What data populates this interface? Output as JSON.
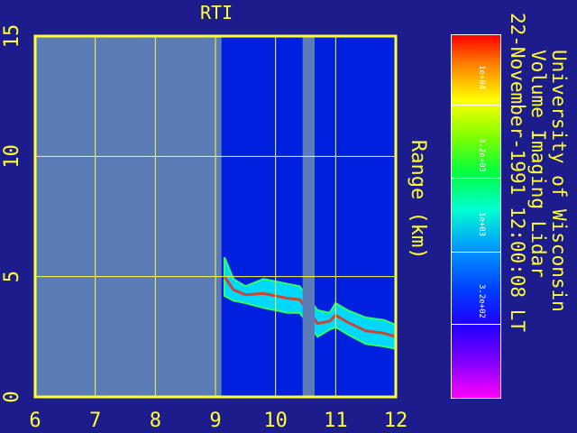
{
  "chart_data": {
    "type": "heatmap",
    "title": "RTI",
    "xlabel": "",
    "ylabel": "Range (km)",
    "xlim": [
      6,
      12
    ],
    "ylim": [
      0,
      15
    ],
    "xticks": [
      "6",
      "7",
      "8",
      "9",
      "10",
      "11",
      "12"
    ],
    "yticks": [
      "0",
      "5",
      "10",
      "15"
    ],
    "grid": true,
    "colorbar": {
      "scale": "log",
      "ticks": [
        "1e+04",
        "3.2e+03",
        "1e+03",
        "3.2e+02"
      ],
      "tick_values": [
        10000,
        3200,
        1000,
        320
      ]
    },
    "no_data_x_ranges": [
      [
        6.0,
        9.1
      ],
      [
        10.45,
        10.65
      ]
    ],
    "echo_layer": [
      {
        "x": 9.15,
        "bottom": 4.2,
        "top": 5.8
      },
      {
        "x": 9.3,
        "bottom": 4.0,
        "top": 4.9
      },
      {
        "x": 9.5,
        "bottom": 3.9,
        "top": 4.6
      },
      {
        "x": 9.8,
        "bottom": 3.7,
        "top": 4.9
      },
      {
        "x": 10.0,
        "bottom": 3.6,
        "top": 4.8
      },
      {
        "x": 10.2,
        "bottom": 3.5,
        "top": 4.7
      },
      {
        "x": 10.4,
        "bottom": 3.5,
        "top": 4.6
      },
      {
        "x": 10.7,
        "bottom": 2.5,
        "top": 3.6
      },
      {
        "x": 10.9,
        "bottom": 2.8,
        "top": 3.5
      },
      {
        "x": 11.0,
        "bottom": 2.9,
        "top": 3.9
      },
      {
        "x": 11.2,
        "bottom": 2.6,
        "top": 3.6
      },
      {
        "x": 11.5,
        "bottom": 2.2,
        "top": 3.3
      },
      {
        "x": 11.8,
        "bottom": 2.1,
        "top": 3.2
      },
      {
        "x": 12.0,
        "bottom": 2.0,
        "top": 3.0
      }
    ]
  },
  "info": {
    "line1": "University of Wisconsin",
    "line2": "Volume Imaging Lidar",
    "line3": "22-November-1991 12:00:08 LT"
  },
  "colors": {
    "background": "#1c1c8c",
    "axis": "#ffff33",
    "no_data": "#5c7cb8",
    "signal_low": "#0020e0",
    "signal_high": "#ff2000"
  }
}
